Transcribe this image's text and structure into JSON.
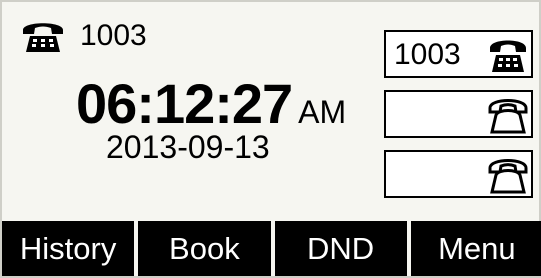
{
  "status": {
    "extension": "1003",
    "phone_icon": "phone-handset-filled-icon"
  },
  "clock": {
    "time": "06:12:27",
    "ampm": "AM",
    "date": "2013-09-13"
  },
  "line_keys": [
    {
      "label": "1003",
      "icon": "phone-registered-icon"
    },
    {
      "label": "",
      "icon": "phone-idle-icon"
    },
    {
      "label": "",
      "icon": "phone-idle-icon"
    }
  ],
  "softkeys": [
    "History",
    "Book",
    "DND",
    "Menu"
  ]
}
